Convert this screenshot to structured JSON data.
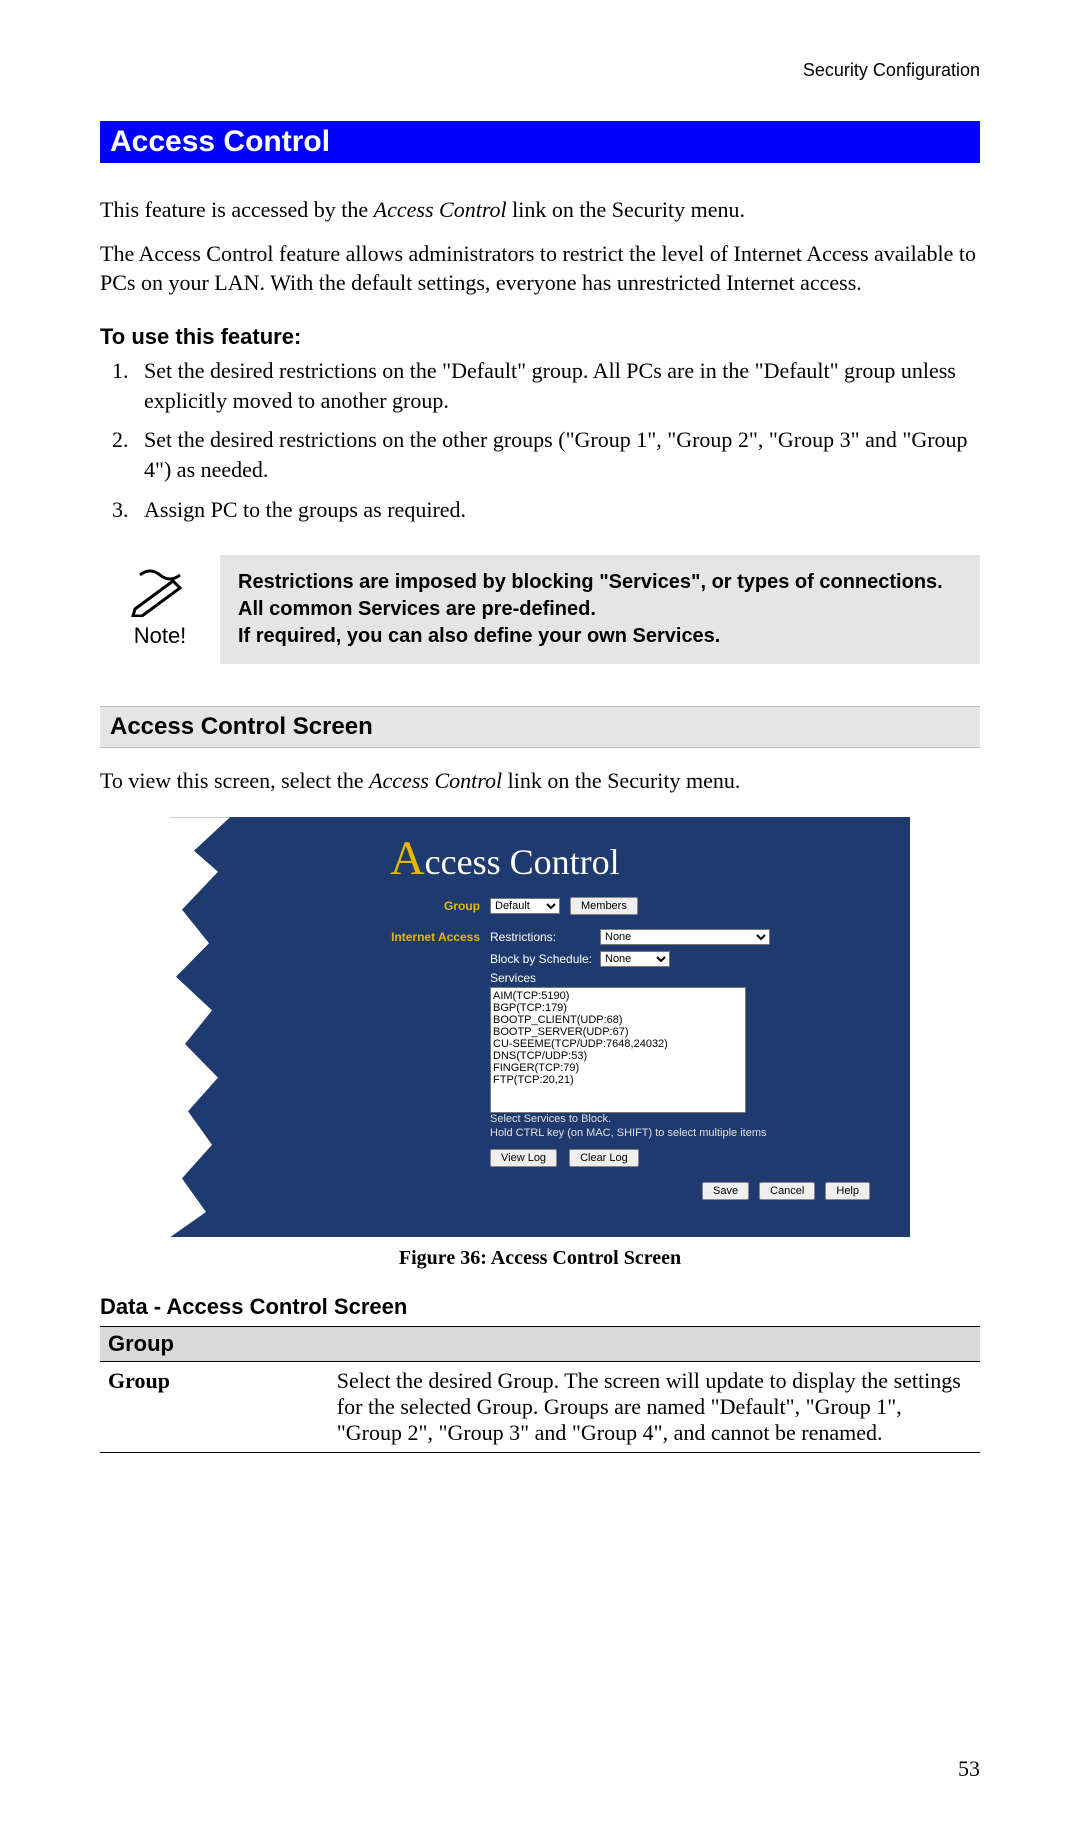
{
  "header": {
    "right": "Security Configuration"
  },
  "section_title": "Access Control",
  "intro1_prefix": "This feature is accessed by the ",
  "intro1_em": "Access Control",
  "intro1_suffix": " link on the Security menu.",
  "intro2": "The Access Control feature allows administrators to restrict the level of Internet Access available to PCs on your LAN. With the default settings, everyone has unrestricted Internet access.",
  "use_heading": "To use this feature:",
  "steps": [
    "Set the desired restrictions on the \"Default\" group. All PCs are in the \"Default\" group unless explicitly moved to another group.",
    "Set the desired restrictions on the other groups (\"Group 1\", \"Group 2\", \"Group 3\" and \"Group 4\") as needed.",
    "Assign PC to the groups as required."
  ],
  "note": {
    "label": "Note!",
    "text": "Restrictions are imposed by blocking \"Services\", or types of connections. All common Services are pre-defined.\nIf required, you can also define your own Services."
  },
  "screen_heading": "Access Control Screen",
  "screen_intro_prefix": "To view this screen, select the ",
  "screen_intro_em": "Access Control",
  "screen_intro_suffix": " link on the Security menu.",
  "screenshot": {
    "title_rest": "ccess Control",
    "labels": {
      "group": "Group",
      "internet_access": "Internet Access",
      "restrictions": "Restrictions:",
      "block_by_schedule": "Block by Schedule:",
      "services": "Services"
    },
    "group_select": "Default",
    "members_btn": "Members",
    "restrictions_select": "None",
    "schedule_select": "None",
    "services_list": [
      "AIM(TCP:5190)",
      "BGP(TCP:179)",
      "BOOTP_CLIENT(UDP:68)",
      "BOOTP_SERVER(UDP:67)",
      "CU-SEEME(TCP/UDP:7648,24032)",
      "DNS(TCP/UDP:53)",
      "FINGER(TCP:79)",
      "FTP(TCP:20,21)"
    ],
    "hint1": "Select Services to Block.",
    "hint2": "Hold CTRL key (on MAC, SHIFT) to select multiple items",
    "buttons": {
      "view_log": "View Log",
      "clear_log": "Clear Log",
      "save": "Save",
      "cancel": "Cancel",
      "help": "Help"
    }
  },
  "figure_caption": "Figure 36: Access Control Screen",
  "data_heading": "Data - Access Control Screen",
  "table": {
    "header": "Group",
    "row_label": "Group",
    "row_text": "Select the desired Group. The screen will update to display the settings for the selected Group. Groups are named \"Default\", \"Group 1\", \"Group 2\", \"Group 3\" and \"Group 4\", and cannot be renamed."
  },
  "page_number": "53"
}
